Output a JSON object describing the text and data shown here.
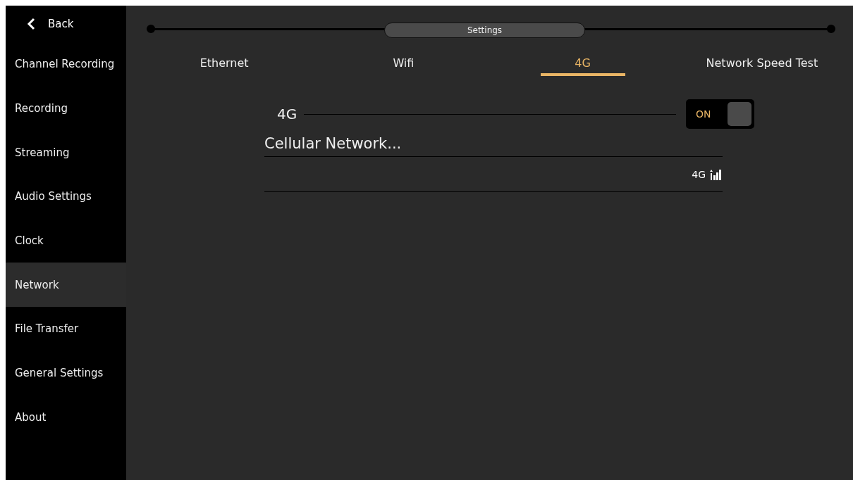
{
  "sidebar": {
    "back": "Back",
    "items": [
      {
        "label": "Channel Recording",
        "selected": false
      },
      {
        "label": "Recording",
        "selected": false
      },
      {
        "label": "Streaming",
        "selected": false
      },
      {
        "label": "Audio Settings",
        "selected": false
      },
      {
        "label": "Clock",
        "selected": false
      },
      {
        "label": "Network",
        "selected": true
      },
      {
        "label": "File Transfer",
        "selected": false
      },
      {
        "label": "General Settings",
        "selected": false
      },
      {
        "label": "About",
        "selected": false
      }
    ]
  },
  "header": {
    "title": "Settings"
  },
  "tabs": [
    {
      "label": "Ethernet",
      "selected": false
    },
    {
      "label": "Wifi",
      "selected": false
    },
    {
      "label": "4G",
      "selected": true
    },
    {
      "label": "Network Speed Test",
      "selected": false
    }
  ],
  "switch_row": {
    "label": "4G",
    "on": true,
    "state_text": "ON"
  },
  "section_title": "Cellular Network...",
  "network_row": {
    "type": "4G"
  }
}
